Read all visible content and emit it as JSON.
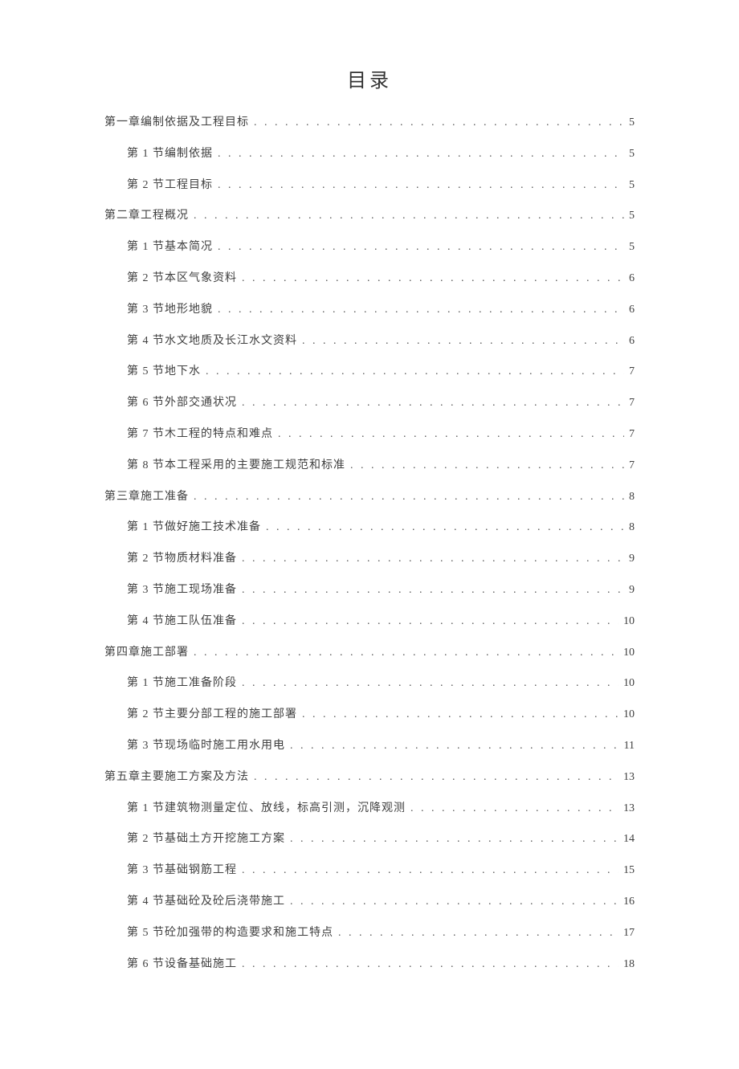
{
  "title": "目录",
  "toc": [
    {
      "level": 1,
      "label": "第一章编制依据及工程目标",
      "page": "5"
    },
    {
      "level": 2,
      "label": "第 1 节编制依据",
      "page": "5"
    },
    {
      "level": 2,
      "label": "第 2 节工程目标",
      "page": "5"
    },
    {
      "level": 1,
      "label": "第二章工程概况",
      "page": "5"
    },
    {
      "level": 2,
      "label": "第 1 节基本简况",
      "page": "5"
    },
    {
      "level": 2,
      "label": "第 2 节本区气象资料",
      "page": "6"
    },
    {
      "level": 2,
      "label": "第 3 节地形地貌",
      "page": "6"
    },
    {
      "level": 2,
      "label": "第 4 节水文地质及长江水文资料",
      "page": "6"
    },
    {
      "level": 2,
      "label": "第 5 节地下水",
      "page": "7"
    },
    {
      "level": 2,
      "label": "第 6 节外部交通状况",
      "page": "7"
    },
    {
      "level": 2,
      "label": "第 7 节木工程的特点和难点",
      "page": "7"
    },
    {
      "level": 2,
      "label": "第 8 节本工程采用的主要施工规范和标准",
      "page": "7"
    },
    {
      "level": 1,
      "label": "第三章施工准备",
      "page": "8"
    },
    {
      "level": 2,
      "label": "第 1 节做好施工技术准备",
      "page": "8"
    },
    {
      "level": 2,
      "label": "第 2 节物质材料准备",
      "page": "9"
    },
    {
      "level": 2,
      "label": "第 3 节施工现场准备",
      "page": "9"
    },
    {
      "level": 2,
      "label": "第 4 节施工队伍准备",
      "page": "10"
    },
    {
      "level": 1,
      "label": "第四章施工部署",
      "page": "10"
    },
    {
      "level": 2,
      "label": "第 1 节施工准备阶段",
      "page": "10"
    },
    {
      "level": 2,
      "label": "第 2 节主要分部工程的施工部署",
      "page": "10"
    },
    {
      "level": 2,
      "label": "第 3 节现场临时施工用水用电",
      "page": "11"
    },
    {
      "level": 1,
      "label": "第五章主要施工方案及方法",
      "page": "13"
    },
    {
      "level": 2,
      "label": "第 1 节建筑物测量定位、放线，标高引测，沉降观测",
      "page": "13"
    },
    {
      "level": 2,
      "label": "第 2 节基础土方开挖施工方案",
      "page": "14"
    },
    {
      "level": 2,
      "label": "第 3 节基础钢筋工程",
      "page": "15"
    },
    {
      "level": 2,
      "label": "第 4 节基础砼及砼后浇带施工",
      "page": "16"
    },
    {
      "level": 2,
      "label": "第 5 节砼加强带的构造要求和施工特点",
      "page": "17"
    },
    {
      "level": 2,
      "label": "第 6 节设备基础施工",
      "page": "18"
    }
  ]
}
